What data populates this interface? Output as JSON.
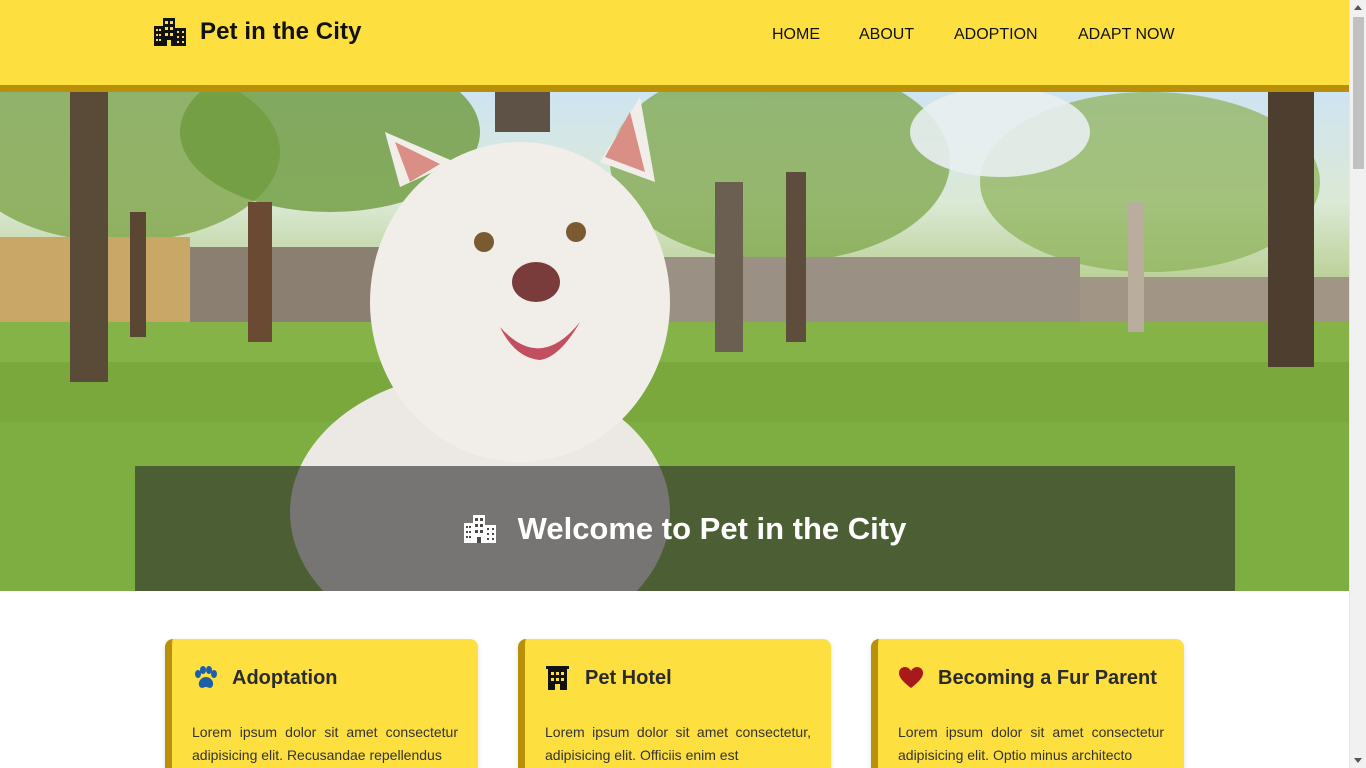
{
  "header": {
    "brand_icon": "city-buildings-icon",
    "brand_name": "Pet in the City",
    "nav": [
      {
        "label": "HOME"
      },
      {
        "label": "ABOUT"
      },
      {
        "label": "ADOPTION"
      },
      {
        "label": "ADAPT NOW"
      }
    ]
  },
  "hero": {
    "image": "white-puppy-in-park",
    "icon": "city-buildings-icon",
    "title": "Welcome to Pet in the City"
  },
  "cards": [
    {
      "icon": "paw-icon",
      "title": "Adoptation",
      "text": "Lorem ipsum dolor sit amet consectetur adipisicing elit. Recusandae repellendus"
    },
    {
      "icon": "hotel-building-icon",
      "title": "Pet Hotel",
      "text": "Lorem ipsum dolor sit amet consectetur, adipisicing elit. Officiis enim est"
    },
    {
      "icon": "heart-icon",
      "title": "Becoming a Fur Parent",
      "text": "Lorem ipsum dolor sit amet consectetur adipisicing elit. Optio minus architecto"
    }
  ],
  "colors": {
    "header_bg": "#fde040",
    "accent_border": "#b8900a",
    "paw_icon": "#1d5fa8",
    "heart_icon": "#a8191c"
  }
}
